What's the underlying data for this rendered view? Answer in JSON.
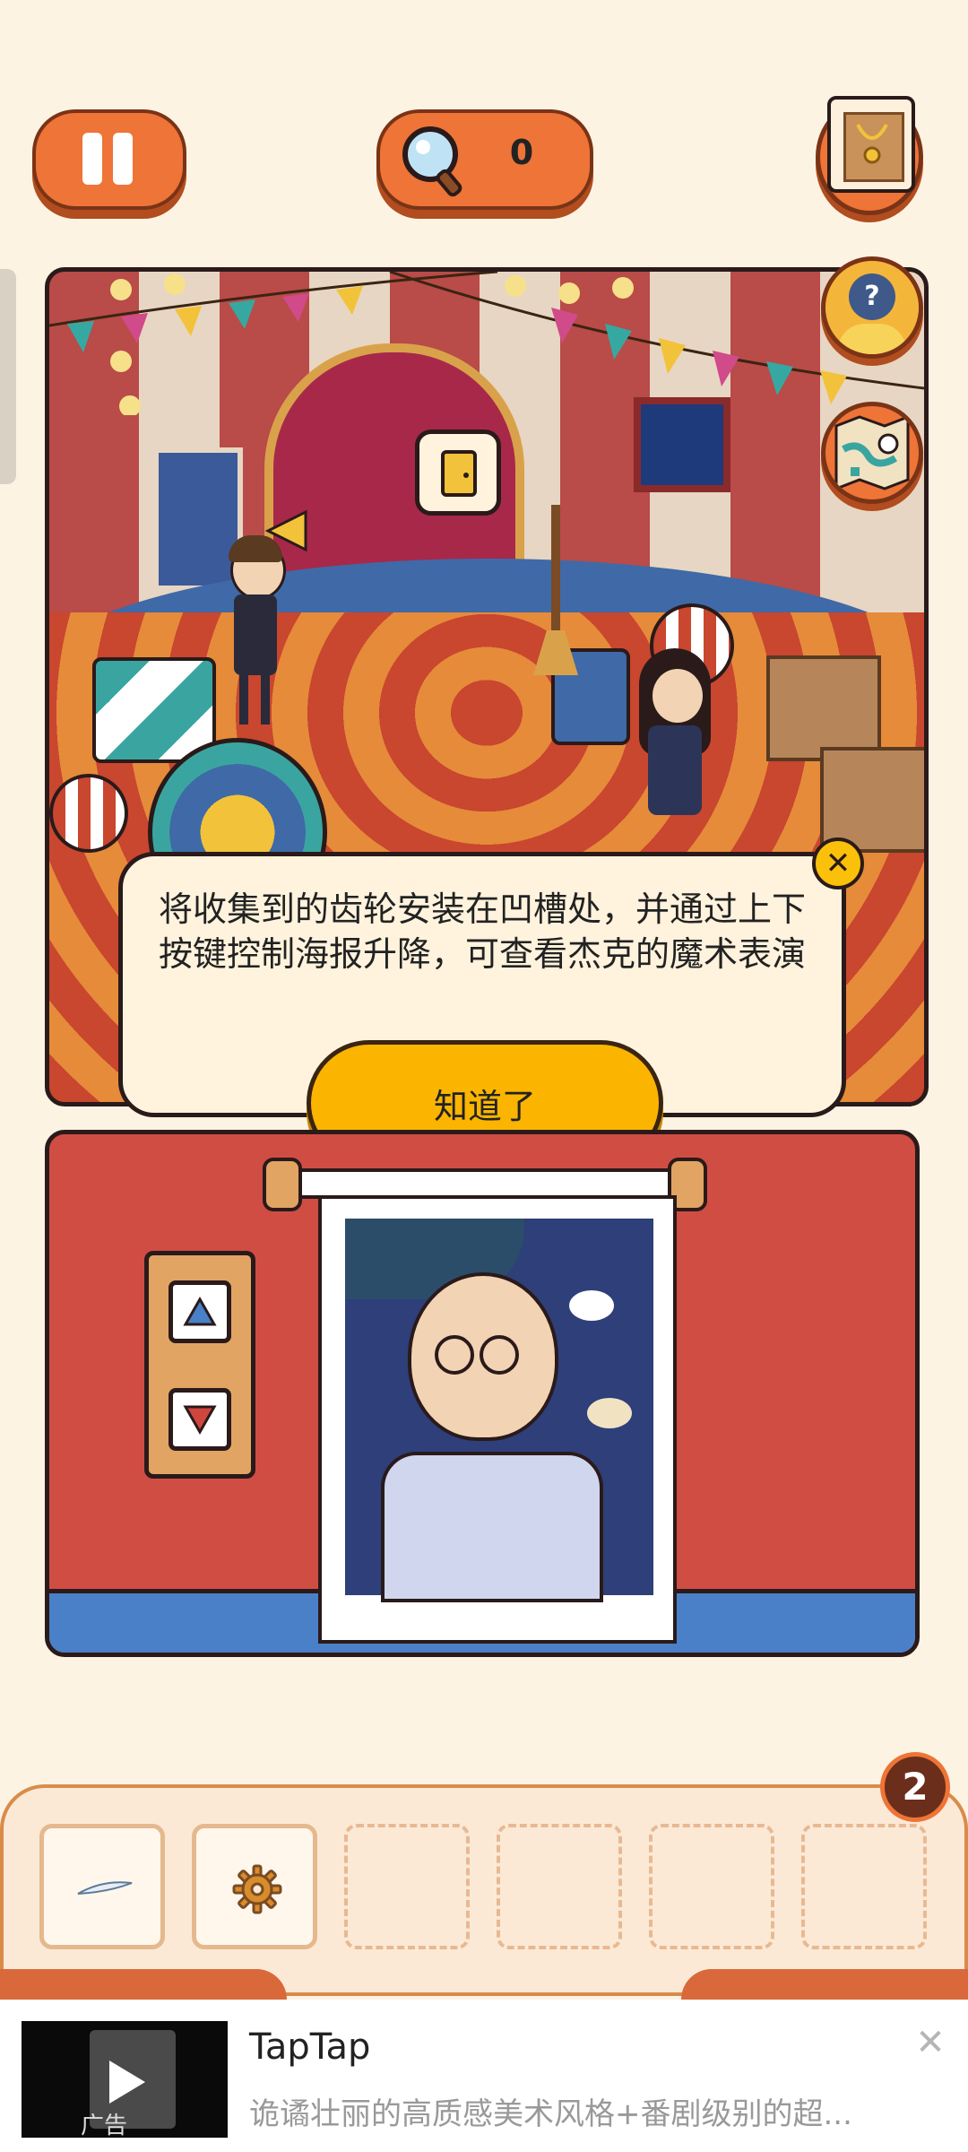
{
  "hud": {
    "hint_count": "0",
    "icons": [
      "pause-icon",
      "magnifier-icon",
      "necklace-picture-icon",
      "help-character-icon",
      "map-icon"
    ]
  },
  "tip": {
    "message": "将收集到的齿轮安装在凹槽处，并通过上下按键控制海报升降，可查看杰克的魔术表演",
    "confirm_label": "知道了"
  },
  "inventory": {
    "badge_count": "2",
    "items": [
      "feather-icon",
      "gear-icon",
      "",
      "",
      "",
      ""
    ]
  },
  "ad": {
    "title": "TapTap",
    "description": "诡谲壮丽的高质感美术风格+番剧级别的超...",
    "tag": "广告"
  },
  "colors": {
    "accent_orange": "#ee7437",
    "button_yellow": "#fbb500",
    "panel_red": "#d04d44",
    "background": "#fdf3e3"
  }
}
